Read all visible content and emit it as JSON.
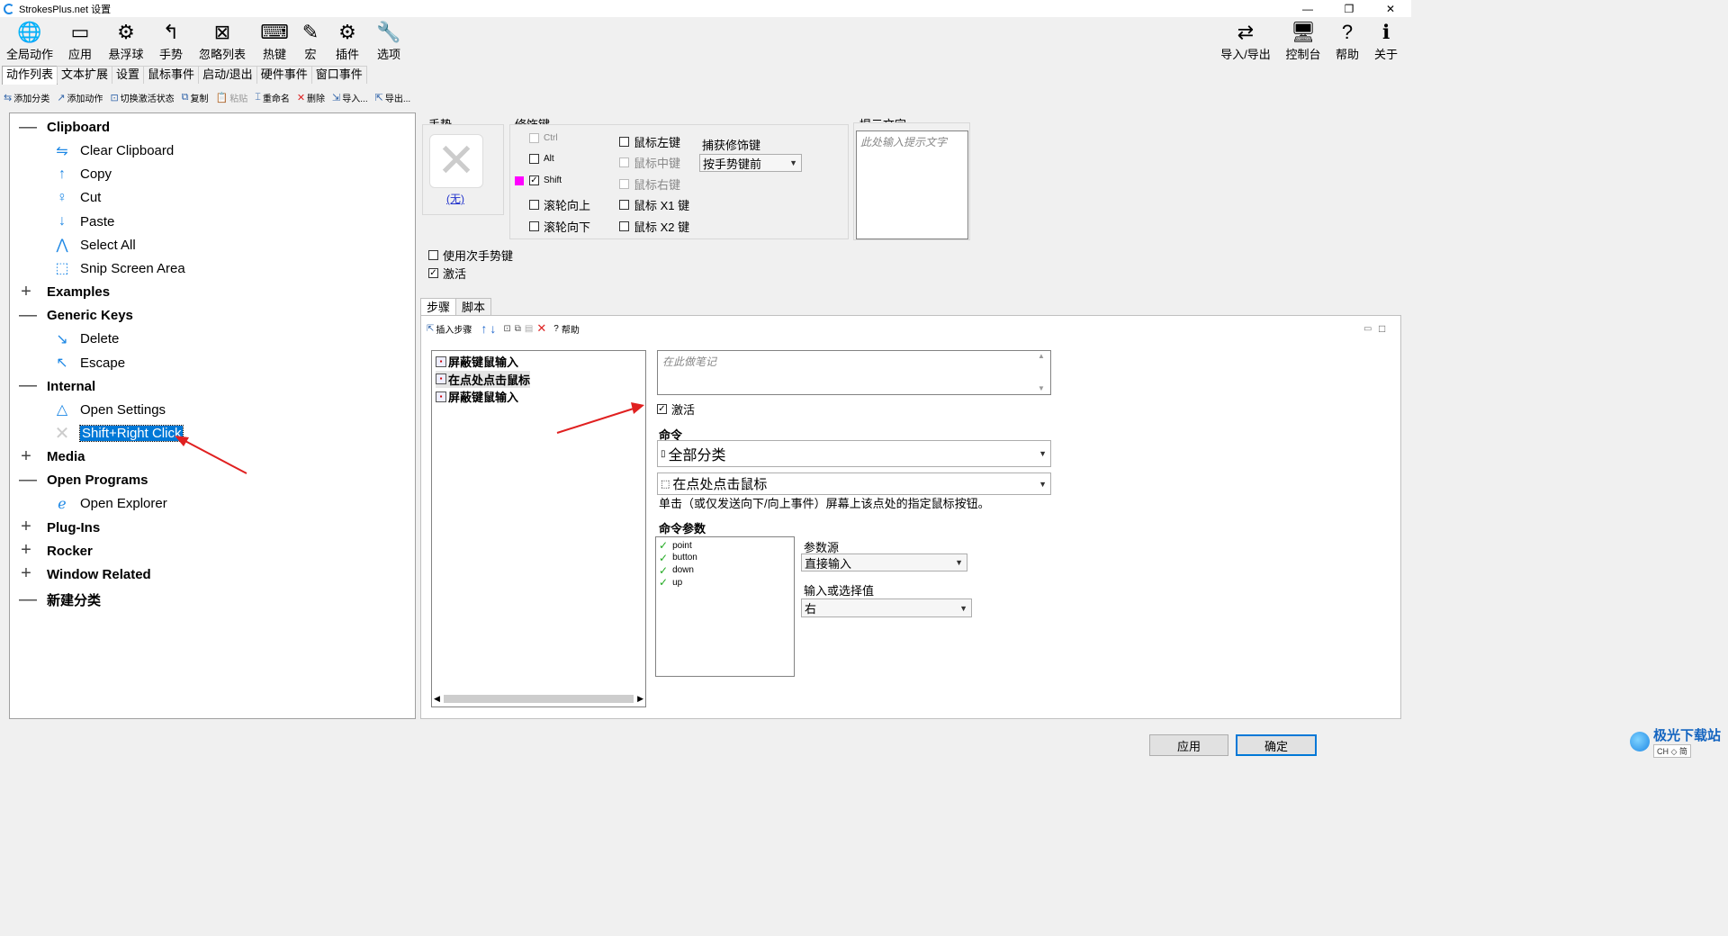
{
  "window": {
    "title": "StrokesPlus.net 设置",
    "min": "—",
    "max": "❐",
    "close": "✕"
  },
  "toolbar": {
    "left": [
      {
        "label": "全局动作",
        "icon": "globe-icon",
        "glyph": "🌐"
      },
      {
        "label": "应用",
        "icon": "window-icon",
        "glyph": "▭"
      },
      {
        "label": "悬浮球",
        "icon": "float-ball-icon",
        "glyph": "⚙"
      },
      {
        "label": "手势",
        "icon": "gesture-icon",
        "glyph": "↰"
      },
      {
        "label": "忽略列表",
        "icon": "ignore-list-icon",
        "glyph": "⊠"
      },
      {
        "label": "热键",
        "icon": "keyboard-icon",
        "glyph": "⌨"
      },
      {
        "label": "宏",
        "icon": "macro-icon",
        "glyph": "✎"
      },
      {
        "label": "插件",
        "icon": "plugin-icon",
        "glyph": "⚙"
      },
      {
        "label": "选项",
        "icon": "wrench-icon",
        "glyph": "🔧"
      }
    ],
    "right": [
      {
        "label": "导入/导出",
        "icon": "import-export-icon",
        "glyph": "⇄"
      },
      {
        "label": "控制台",
        "icon": "console-icon",
        "glyph": "🖥"
      },
      {
        "label": "帮助",
        "icon": "help-icon",
        "glyph": "?"
      },
      {
        "label": "关于",
        "icon": "about-icon",
        "glyph": "ℹ"
      }
    ]
  },
  "tabs": [
    "动作列表",
    "文本扩展",
    "设置",
    "鼠标事件",
    "启动/退出",
    "硬件事件",
    "窗口事件"
  ],
  "subtoolbar": [
    {
      "label": "添加分类",
      "glyph": "⇆",
      "enabled": true
    },
    {
      "label": "添加动作",
      "glyph": "↗",
      "enabled": true
    },
    {
      "label": "切换激活状态",
      "glyph": "⊡",
      "enabled": true
    },
    {
      "label": "复制",
      "glyph": "⧉",
      "enabled": true
    },
    {
      "label": "粘贴",
      "glyph": "📋",
      "enabled": false
    },
    {
      "label": "重命名",
      "glyph": "⌶",
      "enabled": true
    },
    {
      "label": "删除",
      "glyph": "✕",
      "enabled": true
    },
    {
      "label": "导入...",
      "glyph": "⇲",
      "enabled": true
    },
    {
      "label": "导出...",
      "glyph": "⇱",
      "enabled": true
    }
  ],
  "tree": [
    {
      "label": "Clipboard",
      "type": "cat",
      "expanded": true
    },
    {
      "label": "Clear Clipboard",
      "type": "item",
      "glyph": "⇋"
    },
    {
      "label": "Copy",
      "type": "item",
      "glyph": "↑"
    },
    {
      "label": "Cut",
      "type": "item",
      "glyph": "♀"
    },
    {
      "label": "Paste",
      "type": "item",
      "glyph": "↓"
    },
    {
      "label": "Select All",
      "type": "item",
      "glyph": "⋀"
    },
    {
      "label": "Snip Screen Area",
      "type": "item",
      "glyph": "⬚"
    },
    {
      "label": "Examples",
      "type": "cat",
      "expanded": false
    },
    {
      "label": "Generic Keys",
      "type": "cat",
      "expanded": true
    },
    {
      "label": "Delete",
      "type": "item",
      "glyph": "↘"
    },
    {
      "label": "Escape",
      "type": "item",
      "glyph": "↖"
    },
    {
      "label": "Internal",
      "type": "cat",
      "expanded": true
    },
    {
      "label": "Open Settings",
      "type": "item",
      "glyph": "△"
    },
    {
      "label": "Shift+Right Click",
      "type": "item",
      "glyph": "✕",
      "selected": true
    },
    {
      "label": "Media",
      "type": "cat",
      "expanded": false
    },
    {
      "label": "Open Programs",
      "type": "cat",
      "expanded": true
    },
    {
      "label": "Open Explorer",
      "type": "item",
      "glyph": "ℯ"
    },
    {
      "label": "Plug-Ins",
      "type": "cat",
      "expanded": false
    },
    {
      "label": "Rocker",
      "type": "cat",
      "expanded": false
    },
    {
      "label": "Window Related",
      "type": "cat",
      "expanded": false
    },
    {
      "label": "新建分类",
      "type": "cat",
      "expanded": true
    }
  ],
  "gesture": {
    "title": "手势",
    "none_link": "(无)"
  },
  "modifiers": {
    "title": "修饰键",
    "items": [
      {
        "label": "Ctrl",
        "checked": false,
        "disabled": true,
        "small": true
      },
      {
        "label": "Alt",
        "checked": false,
        "disabled": false,
        "small": true
      },
      {
        "label": "Shift",
        "checked": true,
        "disabled": false,
        "small": true
      },
      {
        "label": "滚轮向上",
        "checked": false,
        "disabled": false
      },
      {
        "label": "滚轮向下",
        "checked": false,
        "disabled": false
      },
      {
        "label": "鼠标左键",
        "checked": false,
        "disabled": false
      },
      {
        "label": "鼠标中键",
        "checked": false,
        "disabled": true
      },
      {
        "label": "鼠标右键",
        "checked": false,
        "disabled": true
      },
      {
        "label": "鼠标 X1 键",
        "checked": false,
        "disabled": false
      },
      {
        "label": "鼠标 X2 键",
        "checked": false,
        "disabled": false
      }
    ],
    "capture_label": "捕获修饰键",
    "capture_value": "按手势键前",
    "marker_color": "#ff00ff"
  },
  "hint": {
    "title": "提示文字",
    "placeholder": "此处输入提示文字"
  },
  "options": {
    "secondary": "使用次手势键",
    "active": "激活"
  },
  "step_tabs": [
    "步骤",
    "脚本"
  ],
  "step_toolbar": {
    "insert": "插入步骤",
    "help": "帮助"
  },
  "steps": [
    {
      "label": "屏蔽键鼠输入"
    },
    {
      "label": "在点处点击鼠标",
      "selected": true
    },
    {
      "label": "屏蔽键鼠输入"
    }
  ],
  "detail": {
    "note_placeholder": "在此做笔记",
    "active_label": "激活",
    "command_label": "命令",
    "category_value": "全部分类",
    "command_value": "在点处点击鼠标",
    "description": "单击（或仅发送向下/向上事件）屏幕上该点处的指定鼠标按钮。",
    "params_label": "命令参数",
    "params": [
      "point",
      "button",
      "down",
      "up"
    ],
    "source_label": "参数源",
    "source_value": "直接输入",
    "value_label": "输入或选择值",
    "value_value": "右"
  },
  "buttons": {
    "apply": "应用",
    "ok": "确定"
  },
  "watermark": {
    "brand": "极光下载站",
    "sub": "CH ◇ 简"
  },
  "colors": {
    "accent": "#0078d7",
    "arrow": "#e02020",
    "icon": "#1e88e5"
  }
}
